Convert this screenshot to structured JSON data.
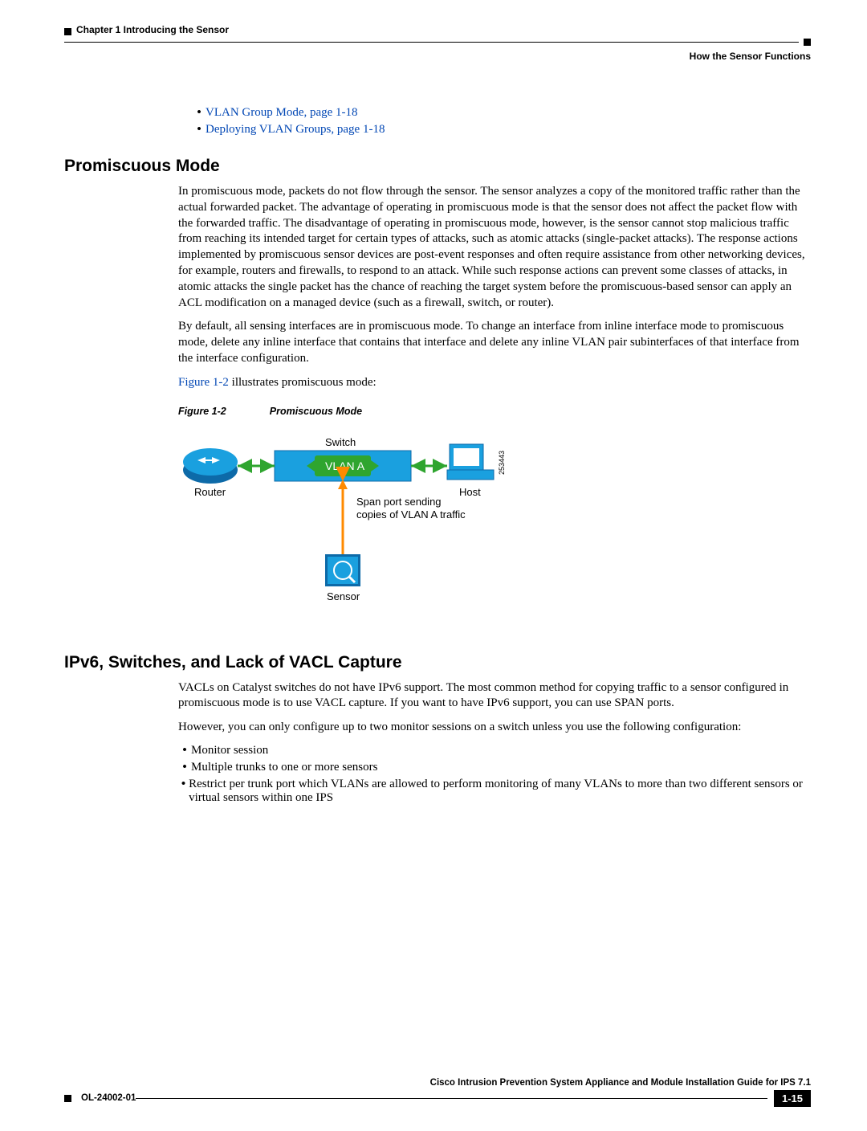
{
  "header": {
    "chapter": "Chapter 1      Introducing the Sensor",
    "section": "How the Sensor Functions"
  },
  "toc": {
    "items": [
      "VLAN Group Mode, page 1-18",
      "Deploying VLAN Groups, page 1-18"
    ]
  },
  "promiscuous": {
    "heading": "Promiscuous Mode",
    "p1": "In promiscuous mode, packets do not flow through the sensor. The sensor analyzes a copy of the monitored traffic rather than the actual forwarded packet. The advantage of operating in promiscuous mode is that the sensor does not affect the packet flow with the forwarded traffic. The disadvantage of operating in promiscuous mode, however, is the sensor cannot stop malicious traffic from reaching its intended target for certain types of attacks, such as atomic attacks (single-packet attacks). The response actions implemented by promiscuous sensor devices are post-event responses and often require assistance from other networking devices, for example, routers and firewalls, to respond to an attack. While such response actions can prevent some classes of attacks, in atomic attacks the single packet has the chance of reaching the target system before the promiscuous-based sensor can apply an ACL modification on a managed device (such as a firewall, switch, or router).",
    "p2": "By default, all sensing interfaces are in promiscuous mode. To change an interface from inline interface mode to promiscuous mode, delete any inline interface that contains that interface and delete any inline VLAN pair subinterfaces of that interface from the interface configuration.",
    "p3_link": "Figure 1-2",
    "p3_tail": " illustrates promiscuous mode:",
    "fig_label": "Figure 1-2",
    "fig_title": "Promiscuous Mode",
    "diagram": {
      "switch": "Switch",
      "router": "Router",
      "host": "Host",
      "vlan": "VLAN A",
      "span1": "Span port sending",
      "span2": "copies of VLAN A traffic",
      "sensor": "Sensor",
      "code": "253443"
    }
  },
  "ipv6": {
    "heading": "IPv6, Switches, and Lack of VACL Capture",
    "p1": "VACLs on Catalyst switches do not have IPv6 support. The most common method for copying traffic to a sensor configured in promiscuous mode is to use VACL capture. If you want to have IPv6 support, you can use SPAN ports.",
    "p2": "However, you can only configure up to two monitor sessions on a switch unless you use the following configuration:",
    "bullets": [
      "Monitor session",
      "Multiple trunks to one or more sensors",
      "Restrict per trunk port which VLANs are allowed to perform monitoring of many VLANs to more than two different sensors or virtual sensors within one IPS"
    ]
  },
  "footer": {
    "title": "Cisco Intrusion Prevention System Appliance and Module Installation Guide for IPS 7.1",
    "doc_id": "OL-24002-01",
    "page": "1-15"
  }
}
